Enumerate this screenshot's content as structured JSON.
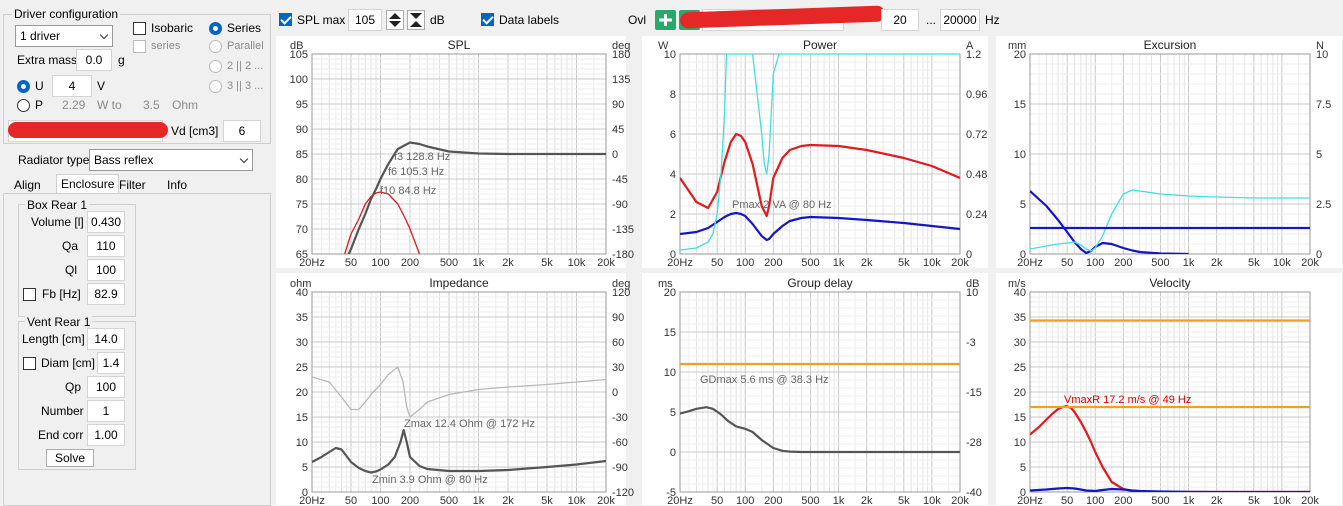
{
  "driver_config": {
    "title": "Driver configuration",
    "driver_count": "1 driver",
    "isobaric": "Isobaric",
    "series_check": "series",
    "series": "Series",
    "parallel": "Parallel",
    "opt2": "2 || 2 ...",
    "opt3": "3 || 3 ...",
    "extra_mass_label": "Extra mass",
    "extra_mass": "0.0",
    "extra_mass_unit": "g",
    "u_label": "U",
    "u_value": "4",
    "u_unit": "V",
    "p_label": "P",
    "p_value": "2.29",
    "p_unit": "W to",
    "ohm_value": "3.5",
    "ohm_unit": "Ohm",
    "vd_label": "Vd [cm3]",
    "vd_value": "6"
  },
  "radiator": {
    "label": "Radiator type",
    "value": "Bass reflex"
  },
  "tabs": [
    "Align",
    "Enclosure",
    "Filter",
    "Info"
  ],
  "box": {
    "title": "Box Rear 1",
    "rows": [
      {
        "label": "Volume [l]",
        "value": "0.430"
      },
      {
        "label": "Qa",
        "value": "110"
      },
      {
        "label": "Ql",
        "value": "100"
      },
      {
        "label": "Fb [Hz]",
        "value": "82.9"
      }
    ]
  },
  "vent": {
    "title": "Vent Rear 1",
    "rows": [
      {
        "label": "Length [cm]",
        "value": "14.0"
      },
      {
        "label": "Diam [cm]",
        "value": "1.4"
      },
      {
        "label": "Qp",
        "value": "100"
      },
      {
        "label": "Number",
        "value": "1"
      },
      {
        "label": "End corr",
        "value": "1.00"
      }
    ],
    "solve": "Solve"
  },
  "toolbar": {
    "spl_max_label": "SPL max",
    "spl_max": "105",
    "db": "dB",
    "data_labels": "Data labels",
    "ovl": "Ovl",
    "f_min": "20",
    "dots": "...",
    "f_max": "20000",
    "hz": "Hz"
  },
  "colors": {
    "red": "#e31a1c",
    "blue": "#1515c8",
    "cyan": "#3fe0e0",
    "orange": "#f0a020",
    "gray": "#555555",
    "lightgray": "#b8b8b8"
  },
  "chart_data": [
    {
      "type": "line",
      "title": "SPL",
      "ylabel": "dB",
      "y2label": "deg",
      "xscale": "log",
      "xlim": [
        20,
        20000
      ],
      "ylim": [
        65,
        105
      ],
      "yticks": [
        "105",
        "100",
        "95",
        "90",
        "85",
        "80",
        "75",
        "70",
        "65"
      ],
      "y2lim": [
        -180,
        180
      ],
      "y2ticks": [
        "180",
        "135",
        "90",
        "45",
        "0",
        "-45",
        "-90",
        "-135",
        "-180"
      ],
      "xticks": [
        "20Hz",
        "50",
        "100",
        "200",
        "500",
        "1k",
        "2k",
        "5k",
        "10k",
        "20k"
      ],
      "annotations": [
        "f3 128.8 Hz",
        "f6 105.3 Hz",
        "f10 84.8 Hz"
      ],
      "series": [
        {
          "color": "gray",
          "x": [
            20,
            30,
            40,
            50,
            60,
            70,
            80,
            90,
            100,
            120,
            150,
            200,
            250,
            300,
            500,
            1000,
            2000,
            5000,
            10000,
            20000
          ],
          "y": [
            52,
            57,
            62,
            66,
            70,
            73,
            76,
            78,
            80,
            83,
            86,
            87.3,
            87,
            86.5,
            85.5,
            85.1,
            85,
            85,
            85,
            85
          ]
        },
        {
          "color": "red",
          "x": [
            30,
            40,
            50,
            60,
            70,
            80,
            90,
            100,
            120,
            150,
            180,
            200,
            250
          ],
          "y": [
            58,
            63,
            69,
            72,
            75,
            76.5,
            77.2,
            77.4,
            77,
            75,
            72,
            70,
            65
          ]
        }
      ]
    },
    {
      "type": "line",
      "title": "Power",
      "ylabel": "W",
      "y2label": "A",
      "xscale": "log",
      "xlim": [
        20,
        20000
      ],
      "ylim": [
        0,
        10
      ],
      "yticks": [
        "10",
        "8",
        "6",
        "4",
        "2",
        "0"
      ],
      "y2lim": [
        0,
        1.2
      ],
      "y2ticks": [
        "1.2",
        "0.96",
        "0.72",
        "0.48",
        "0.24",
        "0"
      ],
      "xticks": [
        "20Hz",
        "50",
        "100",
        "200",
        "500",
        "1k",
        "2k",
        "5k",
        "10k",
        "20k"
      ],
      "annotations": [
        "Pmax 2 VA  @ 80 Hz"
      ],
      "series": [
        {
          "color": "red",
          "x": [
            20,
            30,
            40,
            50,
            60,
            70,
            80,
            90,
            100,
            120,
            150,
            170,
            180,
            200,
            250,
            300,
            400,
            500,
            1000,
            2000,
            5000,
            10000,
            20000
          ],
          "y": [
            3.8,
            2.6,
            2.3,
            3.1,
            4.6,
            5.6,
            6,
            5.9,
            5.6,
            4.5,
            2.4,
            1.9,
            2.4,
            3.8,
            4.8,
            5.2,
            5.4,
            5.45,
            5.4,
            5.2,
            4.8,
            4.4,
            3.8
          ]
        },
        {
          "color": "blue",
          "x": [
            20,
            30,
            40,
            50,
            60,
            70,
            80,
            90,
            100,
            120,
            150,
            170,
            180,
            200,
            250,
            300,
            400,
            500,
            1000,
            2000,
            5000,
            10000,
            20000
          ],
          "y": [
            1.0,
            1.1,
            1.3,
            1.6,
            1.85,
            2.0,
            2.05,
            2.0,
            1.9,
            1.5,
            0.9,
            0.7,
            0.75,
            1.0,
            1.4,
            1.65,
            1.8,
            1.85,
            1.8,
            1.7,
            1.55,
            1.4,
            1.25
          ]
        },
        {
          "color": "cyan",
          "x": [
            20,
            30,
            40,
            45,
            50,
            55,
            60,
            63,
            70,
            80,
            100,
            120,
            150,
            160,
            170,
            180,
            200,
            230,
            250,
            20000
          ],
          "y": [
            0.2,
            0.3,
            0.6,
            1,
            2,
            4,
            7,
            10,
            10,
            10,
            10,
            10,
            6,
            4.5,
            4,
            5,
            9,
            10,
            10,
            10
          ]
        }
      ]
    },
    {
      "type": "line",
      "title": "Excursion",
      "ylabel": "mm",
      "y2label": "N",
      "xscale": "log",
      "xlim": [
        20,
        20000
      ],
      "ylim": [
        0,
        20
      ],
      "yticks": [
        "20",
        "15",
        "10",
        "5",
        "0"
      ],
      "y2lim": [
        0,
        10
      ],
      "y2ticks": [
        "10",
        "7.5",
        "5",
        "2.5",
        "0"
      ],
      "xticks": [
        "20Hz",
        "50",
        "100",
        "200",
        "500",
        "1k",
        "2k",
        "5k",
        "10k",
        "20k"
      ],
      "annotations": [],
      "series": [
        {
          "color": "blue",
          "x": [
            20,
            30,
            40,
            50,
            60,
            70,
            80,
            90,
            100,
            120,
            150,
            200,
            250,
            300,
            500,
            1000
          ],
          "y": [
            6.3,
            4.8,
            3.4,
            2.2,
            1.2,
            0.5,
            0.1,
            0.3,
            0.7,
            1.1,
            1.0,
            0.6,
            0.35,
            0.2,
            0.05,
            0
          ]
        },
        {
          "color": "cyan",
          "x": [
            20,
            30,
            40,
            50,
            60,
            70,
            80,
            90,
            100,
            120,
            150,
            200,
            250,
            300,
            500,
            1000,
            2000,
            5000,
            10000,
            20000
          ],
          "y": [
            0.5,
            0.8,
            1.0,
            1.1,
            1.2,
            0.9,
            0.5,
            0.3,
            0.6,
            1.8,
            4.0,
            6.0,
            6.4,
            6.3,
            6.0,
            5.8,
            5.7,
            5.6,
            5.6,
            5.6
          ]
        },
        {
          "color": "blue",
          "x": [
            20,
            20000
          ],
          "y": [
            2.6,
            2.6
          ]
        }
      ]
    },
    {
      "type": "line",
      "title": "Impedance",
      "ylabel": "ohm",
      "y2label": "deg",
      "xscale": "log",
      "xlim": [
        20,
        20000
      ],
      "ylim": [
        0,
        40
      ],
      "yticks": [
        "40",
        "35",
        "30",
        "25",
        "20",
        "15",
        "10",
        "5",
        "0"
      ],
      "y2lim": [
        -120,
        120
      ],
      "y2ticks": [
        "120",
        "90",
        "60",
        "30",
        "0",
        "-30",
        "-60",
        "-90",
        "-120"
      ],
      "xticks": [
        "20Hz",
        "50",
        "100",
        "200",
        "500",
        "1k",
        "2k",
        "5k",
        "10k",
        "20k"
      ],
      "annotations": [
        "Zmax 12.4 Ohm @ 172 Hz",
        "Zmin 3.9 Ohm @ 80 Hz"
      ],
      "series": [
        {
          "color": "gray",
          "x": [
            20,
            25,
            30,
            35,
            40,
            45,
            50,
            60,
            70,
            80,
            90,
            100,
            120,
            140,
            160,
            172,
            185,
            200,
            250,
            300,
            500,
            1000,
            2000,
            5000,
            10000,
            20000
          ],
          "y": [
            6,
            7,
            8,
            8.8,
            8.5,
            7.2,
            6,
            4.8,
            4.2,
            3.9,
            4.1,
            4.5,
            5.5,
            7,
            10,
            12.4,
            10,
            7,
            5.2,
            4.6,
            4.2,
            4.2,
            4.4,
            5,
            5.5,
            6.2
          ]
        },
        {
          "color": "lightgray",
          "x": [
            20,
            30,
            40,
            50,
            60,
            70,
            80,
            100,
            120,
            150,
            170,
            185,
            200,
            250,
            300,
            500,
            1000,
            2000,
            5000,
            10000,
            20000
          ],
          "y": [
            23,
            22,
            19,
            16.5,
            16.5,
            18,
            19.5,
            21.5,
            23.5,
            25,
            22,
            17,
            15,
            16.5,
            18,
            19.5,
            20.5,
            21,
            21.5,
            22,
            22.5
          ]
        }
      ]
    },
    {
      "type": "line",
      "title": "Group delay",
      "ylabel": "ms",
      "y2label": "dB",
      "xscale": "log",
      "xlim": [
        20,
        20000
      ],
      "ylim": [
        -5,
        20
      ],
      "yticks": [
        "20",
        "15",
        "10",
        "5",
        "0",
        "-5"
      ],
      "y2lim": [
        -40,
        10
      ],
      "y2ticks": [
        "10",
        "-3",
        "-15",
        "-28",
        "-40"
      ],
      "xticks": [
        "20Hz",
        "50",
        "100",
        "200",
        "500",
        "1k",
        "2k",
        "5k",
        "10k",
        "20k"
      ],
      "annotations": [
        "GDmax 5.6 ms  @ 38.3 Hz"
      ],
      "series": [
        {
          "color": "gray",
          "x": [
            20,
            25,
            30,
            38.3,
            45,
            55,
            65,
            80,
            100,
            120,
            150,
            200,
            250,
            300,
            400,
            500,
            1000,
            2000,
            5000,
            20000
          ],
          "y": [
            4.8,
            5.1,
            5.4,
            5.6,
            5.4,
            4.7,
            3.9,
            3.2,
            2.9,
            2.5,
            1.5,
            0.5,
            0.15,
            0.05,
            0,
            0,
            0,
            0,
            0,
            0
          ]
        },
        {
          "color": "orange",
          "x": [
            20,
            20000
          ],
          "y": [
            11,
            11
          ]
        }
      ]
    },
    {
      "type": "line",
      "title": "Velocity",
      "ylabel": "m/s",
      "y2label": "",
      "xscale": "log",
      "xlim": [
        20,
        20000
      ],
      "ylim": [
        0,
        40
      ],
      "yticks": [
        "40",
        "35",
        "30",
        "25",
        "20",
        "15",
        "10",
        "5",
        "0"
      ],
      "y2lim": [],
      "y2ticks": [],
      "xticks": [
        "20Hz",
        "50",
        "100",
        "200",
        "500",
        "1k",
        "2k",
        "5k",
        "10k",
        "20k"
      ],
      "annotations": [
        "VmaxR 17.2 m/s @ 49 Hz"
      ],
      "series": [
        {
          "color": "red",
          "x": [
            20,
            25,
            30,
            35,
            40,
            45,
            49,
            55,
            60,
            70,
            80,
            90,
            100,
            120,
            150,
            200,
            250,
            300,
            500,
            1000,
            20000
          ],
          "y": [
            11.5,
            13,
            14.5,
            15.7,
            16.6,
            17,
            17.2,
            16.8,
            16,
            14,
            12,
            10,
            8,
            5,
            2,
            0.6,
            0.2,
            0.1,
            0,
            0,
            0
          ]
        },
        {
          "color": "blue",
          "x": [
            20,
            30,
            40,
            50,
            60,
            70,
            80,
            100,
            120,
            150,
            200,
            250,
            300,
            500,
            1000,
            2000,
            20000
          ],
          "y": [
            0.3,
            0.5,
            0.7,
            0.8,
            0.7,
            0.5,
            0.3,
            0.2,
            0.4,
            0.6,
            0.5,
            0.3,
            0.2,
            0.1,
            0.05,
            0,
            0
          ]
        },
        {
          "color": "orange",
          "x": [
            20,
            20000
          ],
          "y": [
            34.3,
            34.3
          ]
        },
        {
          "color": "orange",
          "x": [
            20,
            20000
          ],
          "y": [
            17,
            17
          ]
        }
      ]
    }
  ]
}
